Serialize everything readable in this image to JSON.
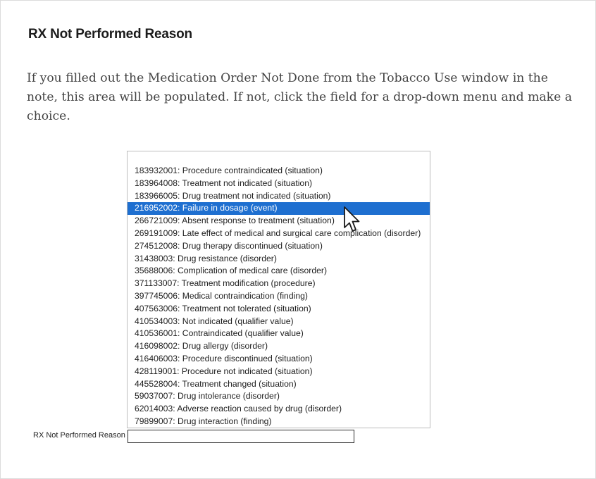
{
  "heading": "RX Not Performed Reason",
  "paragraph": "If you filled out the Medication Order Not Done from the Tobacco Use window in the note, this area will be populated. If not, click the field for a drop-down menu and make a choice.",
  "dropdown": {
    "selected_index": 3,
    "options": [
      "183932001: Procedure contraindicated (situation)",
      "183964008: Treatment not indicated (situation)",
      "183966005: Drug treatment not indicated (situation)",
      "216952002: Failure in dosage (event)",
      "266721009: Absent response to treatment (situation)",
      "269191009: Late effect of medical and surgical care complication (disorder)",
      "274512008: Drug therapy discontinued (situation)",
      "31438003: Drug resistance (disorder)",
      "35688006: Complication of medical care (disorder)",
      "371133007: Treatment modification (procedure)",
      "397745006: Medical contraindication (finding)",
      "407563006: Treatment not tolerated (situation)",
      "410534003: Not indicated (qualifier value)",
      "410536001: Contraindicated (qualifier value)",
      "416098002: Drug allergy (disorder)",
      "416406003: Procedure discontinued (situation)",
      "428119001: Procedure not indicated (situation)",
      "445528004: Treatment changed (situation)",
      "59037007: Drug intolerance (disorder)",
      "62014003: Adverse reaction caused by drug (disorder)",
      "79899007: Drug interaction (finding)"
    ]
  },
  "field": {
    "label": "RX Not Performed Reason",
    "value": ""
  },
  "colors": {
    "selection": "#1e6fd0",
    "selection_text": "#ffffff"
  },
  "icons": {
    "cursor": "mouse-pointer-icon"
  }
}
